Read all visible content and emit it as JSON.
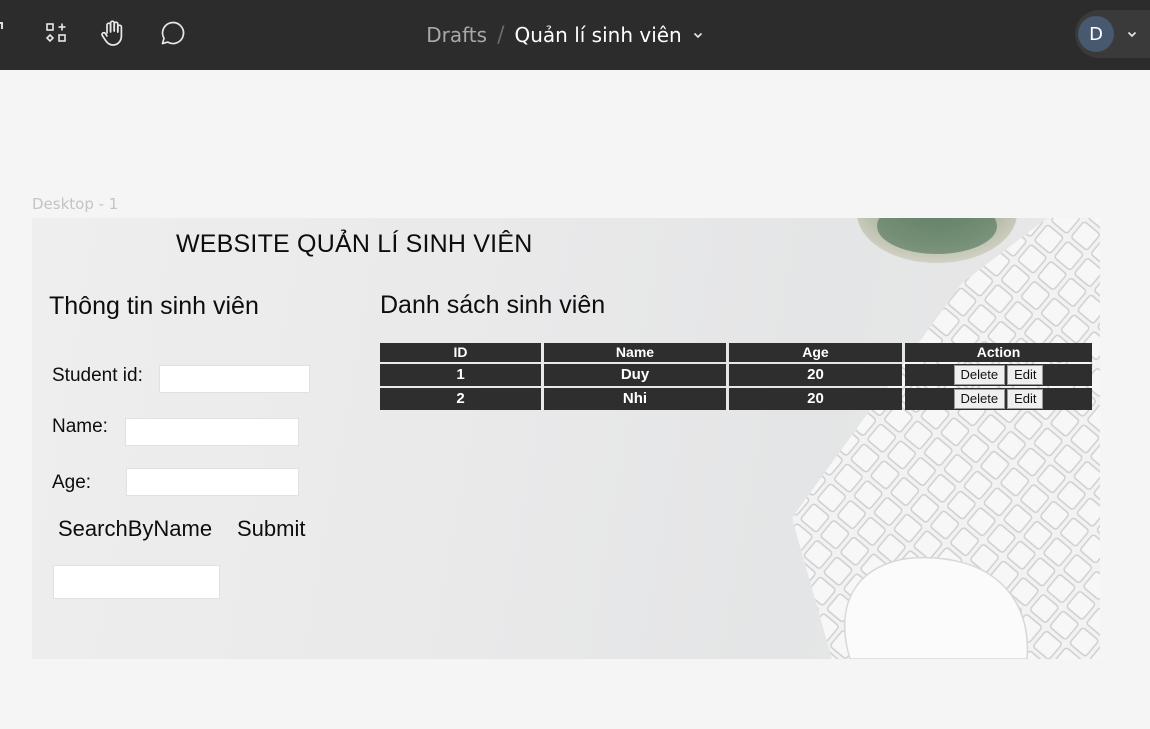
{
  "toolbar": {
    "icons": [
      "partial-edge-icon",
      "components-icon",
      "hand-tool-icon",
      "comment-icon"
    ],
    "breadcrumb": {
      "parent": "Drafts",
      "separator": "/",
      "current": "Quản lí sinh viên"
    },
    "user": {
      "initial": "D"
    }
  },
  "canvas": {
    "frame_label": "Desktop - 1"
  },
  "site": {
    "title": "WEBSITE QUẢN LÍ SINH VIÊN",
    "info_heading": "Thông tin sinh viên",
    "list_heading": "Danh sách sinh viên",
    "form": {
      "student_id_label": "Student id:",
      "student_id_value": "",
      "name_label": "Name:",
      "name_value": "",
      "age_label": "Age:",
      "age_value": "",
      "search_by_name_label": "SearchByName",
      "submit_label": "Submit",
      "search_value": ""
    },
    "table": {
      "headers": [
        "ID",
        "Name",
        "Age",
        "Action"
      ],
      "rows": [
        {
          "id": "1",
          "name": "Duy",
          "age": "20",
          "delete_label": "Delete",
          "edit_label": "Edit"
        },
        {
          "id": "2",
          "name": "Nhi",
          "age": "20",
          "delete_label": "Delete",
          "edit_label": "Edit"
        }
      ]
    }
  },
  "colors": {
    "toolbar_bg": "#2c2c2c",
    "canvas_bg": "#f5f5f5",
    "avatar_bg": "#46596e",
    "table_cell_bg": "#2e2e2e"
  }
}
